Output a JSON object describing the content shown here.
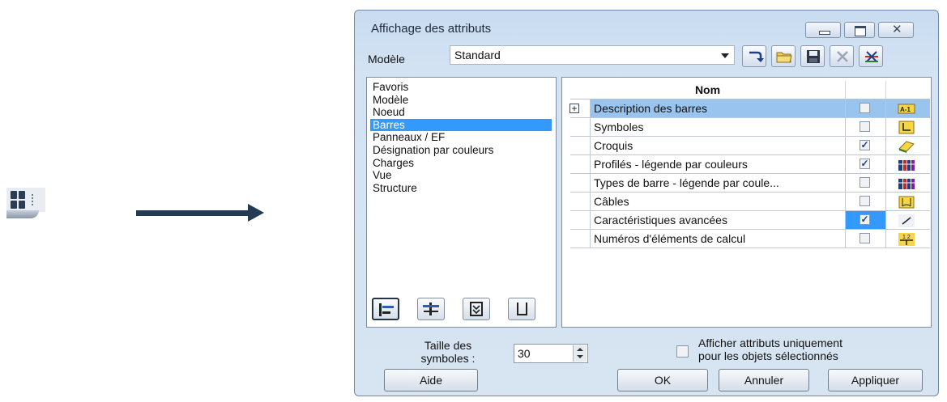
{
  "dialog": {
    "title": "Affichage des attributs",
    "model_label": "Modèle",
    "model_value": "Standard"
  },
  "categories": [
    "Favoris",
    "Modèle",
    "Noeud",
    "Barres",
    "Panneaux / EF",
    "Désignation par couleurs",
    "Charges",
    "Vue",
    "Structure"
  ],
  "selected_category": "Barres",
  "table": {
    "header_name": "Nom",
    "rows": [
      {
        "name": "Description des barres",
        "checked": false,
        "icon": "label-a1-icon",
        "selected": true,
        "expander": "+"
      },
      {
        "name": "Symboles",
        "checked": false,
        "icon": "symbol-l-icon"
      },
      {
        "name": "Croquis",
        "checked": true,
        "icon": "sketch-icon"
      },
      {
        "name": "Profilés - légende par couleurs",
        "checked": true,
        "icon": "color-profile-icon"
      },
      {
        "name": "Types de barre - légende par coule...",
        "checked": false,
        "icon": "bar-type-color-icon"
      },
      {
        "name": "Câbles",
        "checked": false,
        "icon": "cable-icon"
      },
      {
        "name": "Caractéristiques avancées",
        "checked": true,
        "icon": "advanced-icon"
      },
      {
        "name": "Numéros d'éléments de calcul",
        "checked": false,
        "icon": "calc-number-icon"
      }
    ]
  },
  "symbol_size": {
    "label": "Taille des symboles :",
    "value": "30"
  },
  "only_selected": {
    "label_line1": "Afficher attributs uniquement",
    "label_line2": "pour les objets sélectionnés",
    "checked": false
  },
  "buttons": {
    "help": "Aide",
    "ok": "OK",
    "cancel": "Annuler",
    "apply": "Appliquer"
  },
  "colors": {
    "selection": "#3399ff",
    "arrow": "#243b55",
    "dialog_bg": "#d7e4f2"
  }
}
